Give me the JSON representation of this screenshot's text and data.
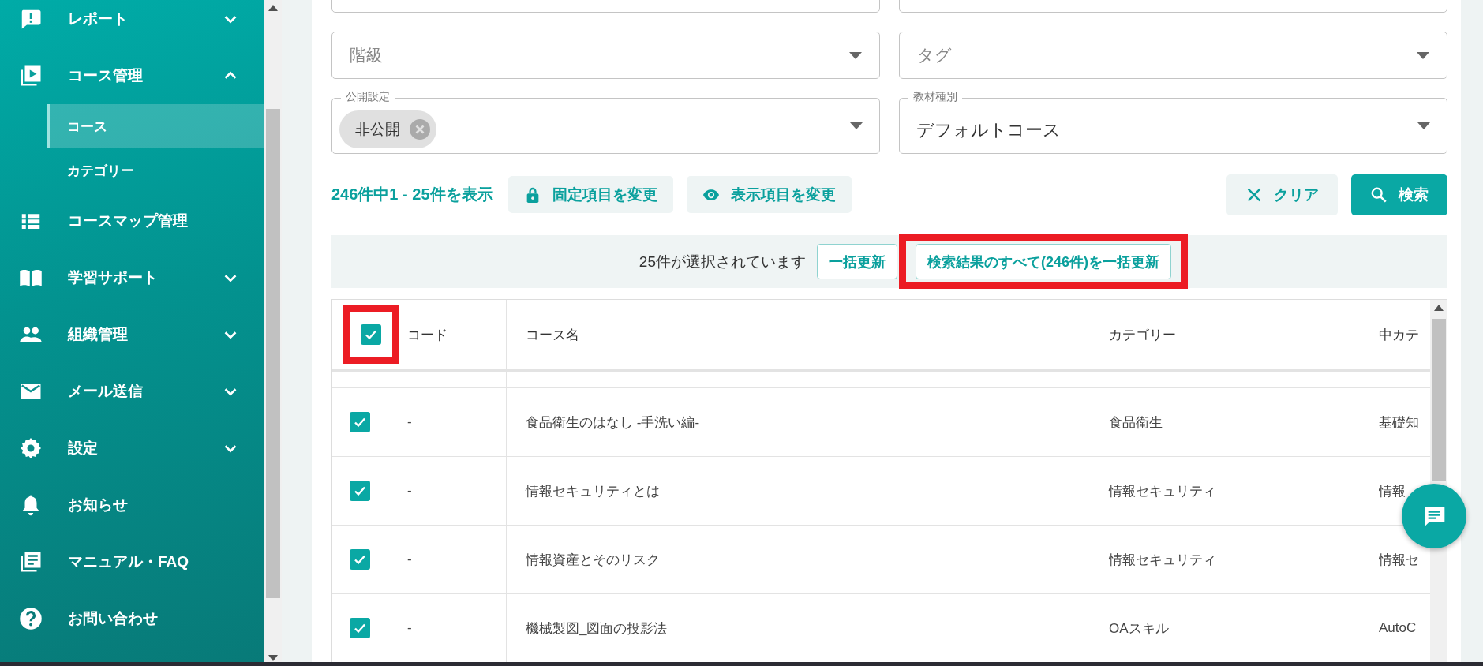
{
  "sidebar": {
    "items": [
      {
        "label": "レポート",
        "expanded": false,
        "selected": false
      },
      {
        "label": "コース管理",
        "expanded": true,
        "selected": false,
        "children": [
          {
            "label": "コース",
            "selected": true
          },
          {
            "label": "カテゴリー",
            "selected": false
          }
        ]
      },
      {
        "label": "コースマップ管理",
        "selected": false
      },
      {
        "label": "学習サポート",
        "expanded": false,
        "selected": false
      },
      {
        "label": "組織管理",
        "expanded": false,
        "selected": false
      },
      {
        "label": "メール送信",
        "expanded": false,
        "selected": false
      },
      {
        "label": "設定",
        "expanded": false,
        "selected": false
      },
      {
        "label": "お知らせ",
        "selected": false
      },
      {
        "label": "マニュアル・FAQ",
        "selected": false
      },
      {
        "label": "お問い合わせ",
        "selected": false
      }
    ]
  },
  "filters": [
    [
      {
        "kind": "select"
      },
      {
        "kind": "select"
      }
    ],
    [
      {
        "kind": "select",
        "label": "階級"
      },
      {
        "kind": "select",
        "label": "タグ"
      }
    ],
    [
      {
        "kind": "chips",
        "label": "公開設定",
        "chips": [
          "非公開"
        ]
      },
      {
        "kind": "select",
        "label": "教材種別",
        "value": "デフォルトコース"
      }
    ]
  ],
  "toolbar": {
    "result_count": "246件中1 - 25件を表示",
    "buttons": [
      {
        "kind": "lock",
        "label": "固定項目を変更"
      },
      {
        "kind": "eye",
        "label": "表示項目を変更"
      },
      {
        "kind": "clear",
        "label": "クリア"
      },
      {
        "kind": "search",
        "label": "検索"
      }
    ]
  },
  "selection_bar": {
    "text": "25件が選択されています",
    "buttons": [
      {
        "label": "一括更新",
        "highlighted": false
      },
      {
        "label": "検索結果のすべて(246件)を一括更新",
        "highlighted": true
      }
    ]
  },
  "table": {
    "select_all": {
      "checked": true,
      "highlighted": true
    },
    "columns": [
      "コード",
      "コース名",
      "カテゴリー",
      "中カテ"
    ],
    "rows": [
      {
        "checked": true,
        "cells": [
          "-",
          "食品衛生のはなし -手洗い編-",
          "食品衛生",
          "基礎知"
        ]
      },
      {
        "checked": true,
        "cells": [
          "-",
          "情報セキュリティとは",
          "情報セキュリティ",
          "情報"
        ]
      },
      {
        "checked": true,
        "cells": [
          "-",
          "情報資産とそのリスク",
          "情報セキュリティ",
          "情報セ"
        ]
      },
      {
        "checked": true,
        "cells": [
          "-",
          "機械製図_図面の投影法",
          "OAスキル",
          "AutoC"
        ]
      }
    ]
  }
}
